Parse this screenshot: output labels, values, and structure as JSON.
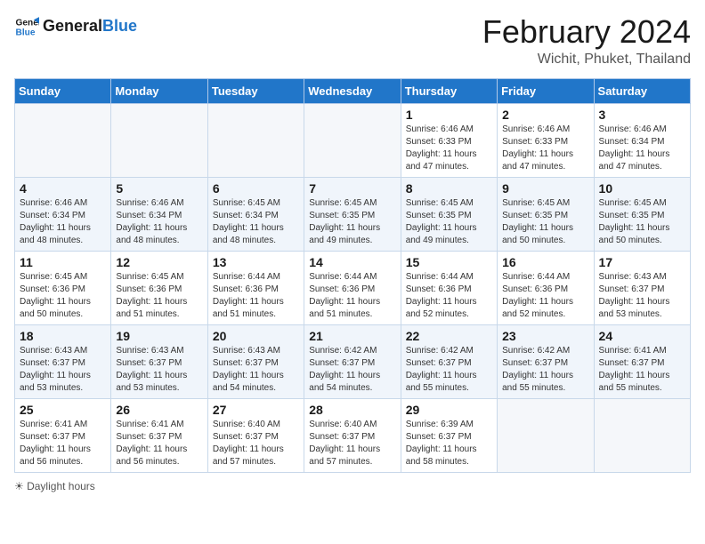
{
  "logo": {
    "text_general": "General",
    "text_blue": "Blue"
  },
  "header": {
    "month": "February 2024",
    "location": "Wichit, Phuket, Thailand"
  },
  "weekdays": [
    "Sunday",
    "Monday",
    "Tuesday",
    "Wednesday",
    "Thursday",
    "Friday",
    "Saturday"
  ],
  "weeks": [
    {
      "days": [
        {
          "num": "",
          "info": ""
        },
        {
          "num": "",
          "info": ""
        },
        {
          "num": "",
          "info": ""
        },
        {
          "num": "",
          "info": ""
        },
        {
          "num": "1",
          "info": "Sunrise: 6:46 AM\nSunset: 6:33 PM\nDaylight: 11 hours and 47 minutes."
        },
        {
          "num": "2",
          "info": "Sunrise: 6:46 AM\nSunset: 6:33 PM\nDaylight: 11 hours and 47 minutes."
        },
        {
          "num": "3",
          "info": "Sunrise: 6:46 AM\nSunset: 6:34 PM\nDaylight: 11 hours and 47 minutes."
        }
      ]
    },
    {
      "days": [
        {
          "num": "4",
          "info": "Sunrise: 6:46 AM\nSunset: 6:34 PM\nDaylight: 11 hours and 48 minutes."
        },
        {
          "num": "5",
          "info": "Sunrise: 6:46 AM\nSunset: 6:34 PM\nDaylight: 11 hours and 48 minutes."
        },
        {
          "num": "6",
          "info": "Sunrise: 6:45 AM\nSunset: 6:34 PM\nDaylight: 11 hours and 48 minutes."
        },
        {
          "num": "7",
          "info": "Sunrise: 6:45 AM\nSunset: 6:35 PM\nDaylight: 11 hours and 49 minutes."
        },
        {
          "num": "8",
          "info": "Sunrise: 6:45 AM\nSunset: 6:35 PM\nDaylight: 11 hours and 49 minutes."
        },
        {
          "num": "9",
          "info": "Sunrise: 6:45 AM\nSunset: 6:35 PM\nDaylight: 11 hours and 50 minutes."
        },
        {
          "num": "10",
          "info": "Sunrise: 6:45 AM\nSunset: 6:35 PM\nDaylight: 11 hours and 50 minutes."
        }
      ]
    },
    {
      "days": [
        {
          "num": "11",
          "info": "Sunrise: 6:45 AM\nSunset: 6:36 PM\nDaylight: 11 hours and 50 minutes."
        },
        {
          "num": "12",
          "info": "Sunrise: 6:45 AM\nSunset: 6:36 PM\nDaylight: 11 hours and 51 minutes."
        },
        {
          "num": "13",
          "info": "Sunrise: 6:44 AM\nSunset: 6:36 PM\nDaylight: 11 hours and 51 minutes."
        },
        {
          "num": "14",
          "info": "Sunrise: 6:44 AM\nSunset: 6:36 PM\nDaylight: 11 hours and 51 minutes."
        },
        {
          "num": "15",
          "info": "Sunrise: 6:44 AM\nSunset: 6:36 PM\nDaylight: 11 hours and 52 minutes."
        },
        {
          "num": "16",
          "info": "Sunrise: 6:44 AM\nSunset: 6:36 PM\nDaylight: 11 hours and 52 minutes."
        },
        {
          "num": "17",
          "info": "Sunrise: 6:43 AM\nSunset: 6:37 PM\nDaylight: 11 hours and 53 minutes."
        }
      ]
    },
    {
      "days": [
        {
          "num": "18",
          "info": "Sunrise: 6:43 AM\nSunset: 6:37 PM\nDaylight: 11 hours and 53 minutes."
        },
        {
          "num": "19",
          "info": "Sunrise: 6:43 AM\nSunset: 6:37 PM\nDaylight: 11 hours and 53 minutes."
        },
        {
          "num": "20",
          "info": "Sunrise: 6:43 AM\nSunset: 6:37 PM\nDaylight: 11 hours and 54 minutes."
        },
        {
          "num": "21",
          "info": "Sunrise: 6:42 AM\nSunset: 6:37 PM\nDaylight: 11 hours and 54 minutes."
        },
        {
          "num": "22",
          "info": "Sunrise: 6:42 AM\nSunset: 6:37 PM\nDaylight: 11 hours and 55 minutes."
        },
        {
          "num": "23",
          "info": "Sunrise: 6:42 AM\nSunset: 6:37 PM\nDaylight: 11 hours and 55 minutes."
        },
        {
          "num": "24",
          "info": "Sunrise: 6:41 AM\nSunset: 6:37 PM\nDaylight: 11 hours and 55 minutes."
        }
      ]
    },
    {
      "days": [
        {
          "num": "25",
          "info": "Sunrise: 6:41 AM\nSunset: 6:37 PM\nDaylight: 11 hours and 56 minutes."
        },
        {
          "num": "26",
          "info": "Sunrise: 6:41 AM\nSunset: 6:37 PM\nDaylight: 11 hours and 56 minutes."
        },
        {
          "num": "27",
          "info": "Sunrise: 6:40 AM\nSunset: 6:37 PM\nDaylight: 11 hours and 57 minutes."
        },
        {
          "num": "28",
          "info": "Sunrise: 6:40 AM\nSunset: 6:37 PM\nDaylight: 11 hours and 57 minutes."
        },
        {
          "num": "29",
          "info": "Sunrise: 6:39 AM\nSunset: 6:37 PM\nDaylight: 11 hours and 58 minutes."
        },
        {
          "num": "",
          "info": ""
        },
        {
          "num": "",
          "info": ""
        }
      ]
    }
  ],
  "legend": "Daylight hours"
}
